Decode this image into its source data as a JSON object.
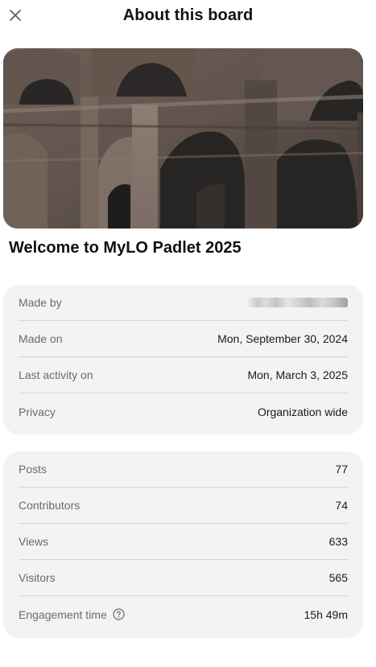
{
  "header": {
    "title": "About this board",
    "close_icon": "close-icon"
  },
  "hero": {
    "image": "colosseum-arches-photo"
  },
  "board": {
    "title": "Welcome to MyLO Padlet 2025"
  },
  "info": {
    "made_by": {
      "label": "Made by",
      "value_redacted": true
    },
    "made_on": {
      "label": "Made on",
      "value": "Mon, September 30, 2024"
    },
    "last_activity": {
      "label": "Last activity on",
      "value": "Mon, March 3, 2025"
    },
    "privacy": {
      "label": "Privacy",
      "value": "Organization wide"
    }
  },
  "stats": {
    "posts": {
      "label": "Posts",
      "value": "77"
    },
    "contributors": {
      "label": "Contributors",
      "value": "74"
    },
    "views": {
      "label": "Views",
      "value": "633"
    },
    "visitors": {
      "label": "Visitors",
      "value": "565"
    },
    "engagement": {
      "label": "Engagement time",
      "value": "15h 49m",
      "help_icon": "question-circle-icon"
    }
  },
  "colors": {
    "card_bg": "#f2f3f5",
    "divider": "#d4d5d9",
    "label_text": "#6b6b70",
    "value_text": "#1a1a1a"
  }
}
